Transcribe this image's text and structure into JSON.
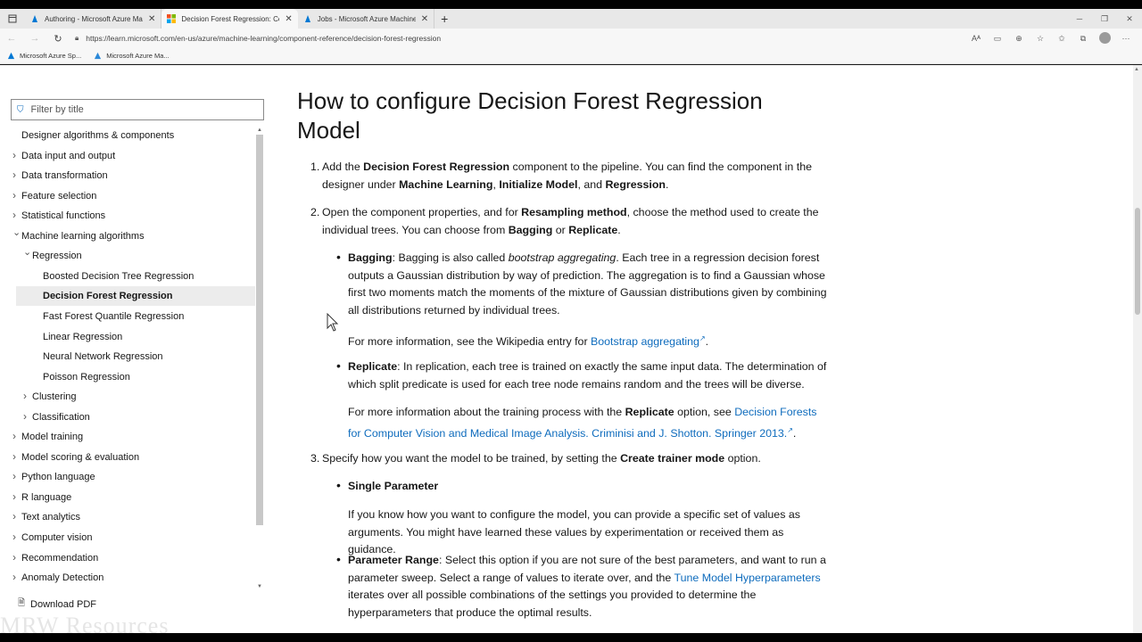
{
  "browser": {
    "tabs": [
      {
        "title": "Authoring - Microsoft Azure Ma",
        "active": false
      },
      {
        "title": "Decision Forest Regression: Com",
        "active": true
      },
      {
        "title": "Jobs - Microsoft Azure Machine",
        "active": false
      }
    ],
    "url": "https://learn.microsoft.com/en-us/azure/machine-learning/component-reference/decision-forest-regression",
    "bookmarks": [
      "Microsoft Azure Sp...",
      "Microsoft Azure Ma..."
    ],
    "new_tab": "+"
  },
  "sidebar": {
    "filter_placeholder": "Filter by title",
    "items": [
      {
        "label": "Designer algorithms & components",
        "level": 0,
        "chevron": ""
      },
      {
        "label": "Data input and output",
        "level": 0,
        "chevron": "right"
      },
      {
        "label": "Data transformation",
        "level": 0,
        "chevron": "right"
      },
      {
        "label": "Feature selection",
        "level": 0,
        "chevron": "right"
      },
      {
        "label": "Statistical functions",
        "level": 0,
        "chevron": "right"
      },
      {
        "label": "Machine learning algorithms",
        "level": 0,
        "chevron": "down"
      },
      {
        "label": "Regression",
        "level": 1,
        "chevron": "down"
      },
      {
        "label": "Boosted Decision Tree Regression",
        "level": 2,
        "chevron": ""
      },
      {
        "label": "Decision Forest Regression",
        "level": 2,
        "chevron": "",
        "selected": true
      },
      {
        "label": "Fast Forest Quantile Regression",
        "level": 2,
        "chevron": ""
      },
      {
        "label": "Linear Regression",
        "level": 2,
        "chevron": ""
      },
      {
        "label": "Neural Network Regression",
        "level": 2,
        "chevron": ""
      },
      {
        "label": "Poisson Regression",
        "level": 2,
        "chevron": ""
      },
      {
        "label": "Clustering",
        "level": 1,
        "chevron": "right"
      },
      {
        "label": "Classification",
        "level": 1,
        "chevron": "right"
      },
      {
        "label": "Model training",
        "level": 0,
        "chevron": "right"
      },
      {
        "label": "Model scoring & evaluation",
        "level": 0,
        "chevron": "right"
      },
      {
        "label": "Python language",
        "level": 0,
        "chevron": "right"
      },
      {
        "label": "R language",
        "level": 0,
        "chevron": "right"
      },
      {
        "label": "Text analytics",
        "level": 0,
        "chevron": "right"
      },
      {
        "label": "Computer vision",
        "level": 0,
        "chevron": "right"
      },
      {
        "label": "Recommendation",
        "level": 0,
        "chevron": "right"
      },
      {
        "label": "Anomaly Detection",
        "level": 0,
        "chevron": "right"
      }
    ],
    "download_pdf": "Download PDF",
    "watermark": "MRW Resources"
  },
  "article": {
    "title_line1": "How to configure Decision Forest Regression",
    "title_line2": "Model"
  }
}
